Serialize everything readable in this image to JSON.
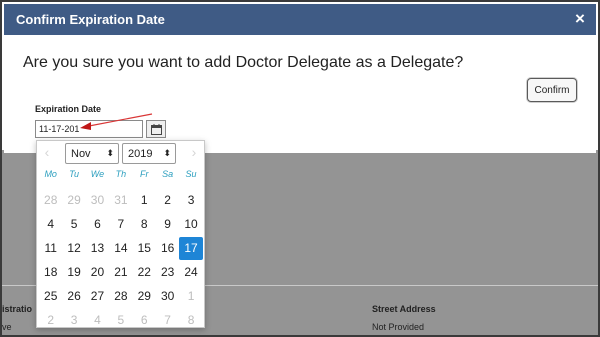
{
  "modal": {
    "title": "Confirm Expiration Date",
    "close_symbol": "×",
    "question": "Are you sure you want to add Doctor Delegate as a Delegate?",
    "confirm_label": "Confirm",
    "expiration_label": "Expiration Date",
    "expiration_value": "11-17-201",
    "calendar_icon": "calendar-icon"
  },
  "datepicker": {
    "prev_symbol": "‹",
    "next_symbol": "›",
    "month": "Nov",
    "year": "2019",
    "select_arrow": "⬍",
    "weekdays": [
      "Mo",
      "Tu",
      "We",
      "Th",
      "Fr",
      "Sa",
      "Su"
    ],
    "weeks": [
      [
        {
          "d": "28",
          "o": true
        },
        {
          "d": "29",
          "o": true
        },
        {
          "d": "30",
          "o": true
        },
        {
          "d": "31",
          "o": true
        },
        {
          "d": "1"
        },
        {
          "d": "2"
        },
        {
          "d": "3"
        }
      ],
      [
        {
          "d": "4"
        },
        {
          "d": "5"
        },
        {
          "d": "6"
        },
        {
          "d": "7"
        },
        {
          "d": "8"
        },
        {
          "d": "9"
        },
        {
          "d": "10"
        }
      ],
      [
        {
          "d": "11"
        },
        {
          "d": "12"
        },
        {
          "d": "13"
        },
        {
          "d": "14"
        },
        {
          "d": "15"
        },
        {
          "d": "16"
        },
        {
          "d": "17",
          "s": true
        }
      ],
      [
        {
          "d": "18"
        },
        {
          "d": "19"
        },
        {
          "d": "20"
        },
        {
          "d": "21"
        },
        {
          "d": "22"
        },
        {
          "d": "23"
        },
        {
          "d": "24"
        }
      ],
      [
        {
          "d": "25"
        },
        {
          "d": "26"
        },
        {
          "d": "27"
        },
        {
          "d": "28"
        },
        {
          "d": "29"
        },
        {
          "d": "30"
        },
        {
          "d": "1",
          "o": true
        }
      ],
      [
        {
          "d": "2",
          "o": true
        },
        {
          "d": "3",
          "o": true
        },
        {
          "d": "4",
          "o": true
        },
        {
          "d": "5",
          "o": true
        },
        {
          "d": "6",
          "o": true
        },
        {
          "d": "7",
          "o": true
        },
        {
          "d": "8",
          "o": true
        }
      ]
    ],
    "selected_color": "#1e85d6"
  },
  "background": {
    "col1_label": "istratio",
    "col1_value": "ve",
    "col2_label": "Street Address",
    "col2_value": "Not Provided"
  },
  "colors": {
    "header": "#3f5b85",
    "annotation_arrow": "#d93636"
  }
}
